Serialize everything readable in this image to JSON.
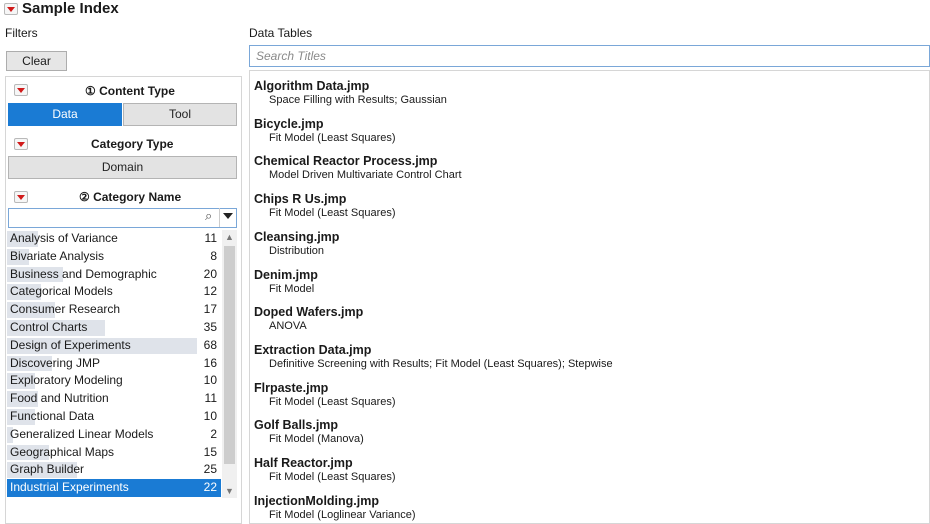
{
  "app": {
    "title": "Sample Index"
  },
  "filters": {
    "label": "Filters",
    "clear_label": "Clear",
    "content_type": {
      "heading": "① Content Type",
      "options": [
        "Data",
        "Tool"
      ],
      "selected": "Data"
    },
    "category_type": {
      "heading": "Category Type",
      "value": "Domain"
    },
    "category_name": {
      "heading": "② Category Name",
      "search_value": "",
      "items": [
        {
          "name": "Analysis of Variance",
          "count": "11"
        },
        {
          "name": "Bivariate Analysis",
          "count": "8"
        },
        {
          "name": "Business and Demographic",
          "count": "20"
        },
        {
          "name": "Categorical Models",
          "count": "12"
        },
        {
          "name": "Consumer Research",
          "count": "17"
        },
        {
          "name": "Control Charts",
          "count": "35"
        },
        {
          "name": "Design of Experiments",
          "count": "68"
        },
        {
          "name": "Discovering JMP",
          "count": "16"
        },
        {
          "name": "Exploratory Modeling",
          "count": "10"
        },
        {
          "name": "Food and Nutrition",
          "count": "11"
        },
        {
          "name": "Functional Data",
          "count": "10"
        },
        {
          "name": "Generalized Linear Models",
          "count": "2"
        },
        {
          "name": "Geographical Maps",
          "count": "15"
        },
        {
          "name": "Graph Builder",
          "count": "25"
        },
        {
          "name": "Industrial Experiments",
          "count": "22"
        }
      ],
      "selected": "Industrial Experiments"
    }
  },
  "data_tables": {
    "label": "Data Tables",
    "search_placeholder": "Search Titles",
    "items": [
      {
        "name": "Algorithm Data.jmp",
        "desc": "Space Filling with Results; Gaussian"
      },
      {
        "name": "Bicycle.jmp",
        "desc": "Fit Model (Least Squares)"
      },
      {
        "name": "Chemical Reactor Process.jmp",
        "desc": "Model Driven Multivariate Control Chart"
      },
      {
        "name": "Chips R Us.jmp",
        "desc": "Fit Model (Least Squares)"
      },
      {
        "name": "Cleansing.jmp",
        "desc": "Distribution"
      },
      {
        "name": "Denim.jmp",
        "desc": "Fit Model"
      },
      {
        "name": "Doped Wafers.jmp",
        "desc": "ANOVA"
      },
      {
        "name": "Extraction Data.jmp",
        "desc": "Definitive Screening with Results; Fit Model (Least Squares); Stepwise"
      },
      {
        "name": "Flrpaste.jmp",
        "desc": "Fit Model (Least Squares)"
      },
      {
        "name": "Golf Balls.jmp",
        "desc": "Fit Model (Manova)"
      },
      {
        "name": "Half Reactor.jmp",
        "desc": "Fit Model (Least Squares)"
      },
      {
        "name": "InjectionMolding.jmp",
        "desc": "Fit Model (Loglinear Variance)"
      }
    ]
  },
  "colors": {
    "accent": "#1a7bd4",
    "disclosure": "#d11a1a",
    "count_bar": "#dfe3ea"
  },
  "icons": {
    "disclosure": "red-triangle-menu-icon",
    "search": "magnifier-icon",
    "dropdown": "chevron-down-icon"
  }
}
